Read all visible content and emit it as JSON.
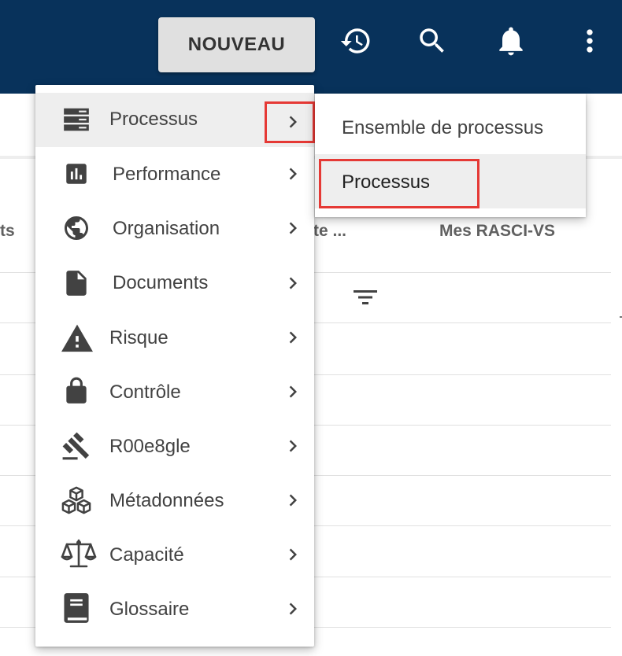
{
  "appbar": {
    "new_button_label": "NOUVEAU",
    "background_color": "#08325b",
    "icons": [
      "history-icon",
      "search-icon",
      "notifications-bell-icon",
      "more-vert-icon"
    ]
  },
  "background_table": {
    "columns": [
      "ts",
      "te ...",
      "Mes RASCI-VS"
    ]
  },
  "menu": {
    "items": [
      {
        "label": "Processus",
        "icon": "server-stack-icon",
        "active": true
      },
      {
        "label": "Performance",
        "icon": "bar-chart-icon"
      },
      {
        "label": "Organisation",
        "icon": "globe-icon"
      },
      {
        "label": "Documents",
        "icon": "document-icon"
      },
      {
        "label": "Risque",
        "icon": "warning-icon"
      },
      {
        "label": "Contrôle",
        "icon": "lock-icon"
      },
      {
        "label": "R00e8gle",
        "icon": "gavel-icon"
      },
      {
        "label": "Métadonnées",
        "icon": "cubes-icon"
      },
      {
        "label": "Capacité",
        "icon": "balance-scale-icon"
      },
      {
        "label": "Glossaire",
        "icon": "book-icon"
      }
    ]
  },
  "submenu": {
    "items": [
      {
        "label": "Ensemble de processus"
      },
      {
        "label": "Processus",
        "active": true
      }
    ]
  },
  "highlight_color": "#e53935"
}
